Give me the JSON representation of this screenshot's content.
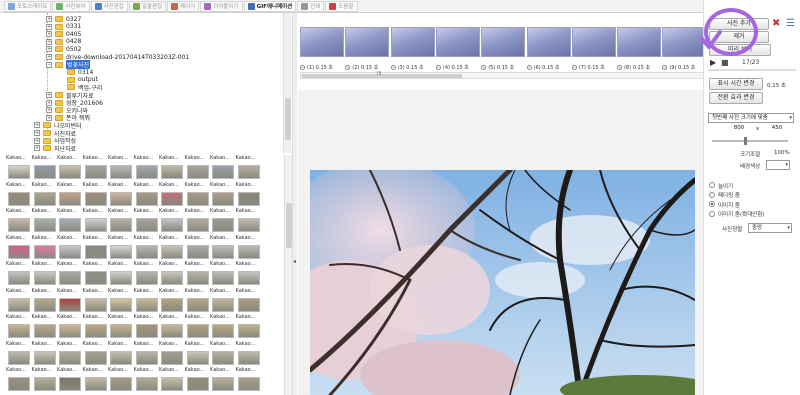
{
  "tabs": [
    {
      "label": "포토스케이프",
      "active": false,
      "color": "#7fa6d8"
    },
    {
      "label": "사진뷰어",
      "active": false,
      "color": "#6bb36b"
    },
    {
      "label": "사진편집",
      "active": false,
      "color": "#4b82c4"
    },
    {
      "label": "일괄편집",
      "active": false,
      "color": "#7aa84a"
    },
    {
      "label": "페이지",
      "active": false,
      "color": "#c4684b"
    },
    {
      "label": "이어붙이기",
      "active": false,
      "color": "#a56bc4"
    },
    {
      "label": "GIF애니메이션",
      "active": true,
      "color": "#3f6fb8"
    },
    {
      "label": "인쇄",
      "active": false,
      "color": "#999999"
    },
    {
      "label": "도움말",
      "active": false,
      "color": "#d04040"
    }
  ],
  "tree": [
    {
      "label": "0327",
      "depth": 3
    },
    {
      "label": "0331",
      "depth": 3
    },
    {
      "label": "0405",
      "depth": 3
    },
    {
      "label": "0428",
      "depth": 3
    },
    {
      "label": "0502",
      "depth": 3
    },
    {
      "label": "drive-download-20170414T033203Z-001",
      "depth": 3
    },
    {
      "label": "벚꽃사진",
      "depth": 3,
      "selected": true,
      "expanded": true
    },
    {
      "label": "0314",
      "depth": 4
    },
    {
      "label": "output",
      "depth": 4
    },
    {
      "label": "백업-구리",
      "depth": 4
    },
    {
      "label": "블루기자료",
      "depth": 3
    },
    {
      "label": "성장_201606",
      "depth": 3
    },
    {
      "label": "오키나와",
      "depth": 3
    },
    {
      "label": "폰아 뭐뭐",
      "depth": 3
    },
    {
      "label": "나오미번터",
      "depth": 2
    },
    {
      "label": "사진자료",
      "depth": 2
    },
    {
      "label": "사업작성",
      "depth": 2
    },
    {
      "label": "지난자료",
      "depth": 2
    }
  ],
  "grid": {
    "caption": "Kakao...",
    "rows": [
      [
        "#d9d3c8",
        "#8f9aa6",
        "#c7bfae",
        "#a7a39a",
        "#b3b7ba",
        "#9ea8ad",
        "#c1b9a5",
        "#aaa39b",
        "#98a4b1",
        "#b7ad9d"
      ],
      [
        "#9c8c74",
        "#b0a48f",
        "#c9a08c",
        "#9e8d7a",
        "#d0b3a0",
        "#a69886",
        "#c36b7b",
        "#a89a86",
        "#b39f8a",
        "#8c8478"
      ],
      [
        "#c9b6a8",
        "#a8b2a7",
        "#a3aeb6",
        "#cfd3d6",
        "#b8b1a6",
        "#aaa49b",
        "#c3c6c8",
        "#b4aa9c",
        "#9e9a93",
        "#c2b8ad"
      ],
      [
        "#d55d8a",
        "#e07aa0",
        "#c6c9cc",
        "#8b8b7d",
        "#d3d6d8",
        "#b4b5b0",
        "#c9c2b4",
        "#a9aba6",
        "#bdbfbd",
        "#b8b9b4"
      ],
      [
        "#bfc2c0",
        "#c6c8c4",
        "#a8aaa6",
        "#8f8f88",
        "#cfd0cc",
        "#b2b3ae",
        "#c8c5bd",
        "#b7b3a9",
        "#bcbdb9",
        "#c3c4bf"
      ],
      [
        "#c9bda3",
        "#b7a98c",
        "#a8453a",
        "#c9b8a0",
        "#d6c59d",
        "#cab98f",
        "#b4a27d",
        "#b8a888",
        "#c2b495",
        "#ab9d80"
      ],
      [
        "#c4b58e",
        "#b9a883",
        "#cbb992",
        "#bda983",
        "#c6b48b",
        "#a69677",
        "#c7b892",
        "#b2a17d",
        "#bca985",
        "#c1b08a"
      ],
      [
        "#bdb7aa",
        "#c9c3b5",
        "#b2ab9c",
        "#a7a193",
        "#c3bdaf",
        "#b8b2a4",
        "#a39d8f",
        "#cac4b6",
        "#b6b0a2",
        "#bfb9ab"
      ],
      [
        "#9a8f7c",
        "#b8ae98",
        "#7d7466",
        "#c3b9a3",
        "#a59b86",
        "#b4aa94",
        "#c8bea8",
        "#968c78",
        "#bbb19b",
        "#aba18b"
      ]
    ]
  },
  "filmstrip": {
    "frames": [
      {
        "label": "(1) 0.15 초"
      },
      {
        "label": "(2) 0.15 초"
      },
      {
        "label": "(3) 0.15 초"
      },
      {
        "label": "(4) 0.15 초"
      },
      {
        "label": "(5) 0.15 초"
      },
      {
        "label": "(6) 0.15 초"
      },
      {
        "label": "(7) 0.15 초"
      },
      {
        "label": "(8) 0.15 초"
      },
      {
        "label": "(9) 0.15 초"
      }
    ],
    "scroll_grip": "III"
  },
  "panel": {
    "add_photo": "사진 추가",
    "remove": "제거",
    "preview": "미리 보기",
    "frame_counter": "17/23",
    "change_time": "표시 시간 변경",
    "time_value": "0.15 초",
    "change_effect": "전환 효과 변경",
    "size_mode": "첫번째 사진 크기에 맞춤",
    "width": "800",
    "times": "x",
    "height": "450",
    "resize_label": "크기조절",
    "resize_value": "100%",
    "bg_label": "배경색상",
    "fit_options": [
      {
        "label": "늘이기",
        "on": false
      },
      {
        "label": "패더링 줌",
        "on": false
      },
      {
        "label": "이미지 줌",
        "on": true
      },
      {
        "label": "이미지 줌(확대안함)",
        "on": false
      }
    ],
    "align_label": "사진정렬",
    "align_value": "중앙",
    "accent": "#a566e0"
  }
}
